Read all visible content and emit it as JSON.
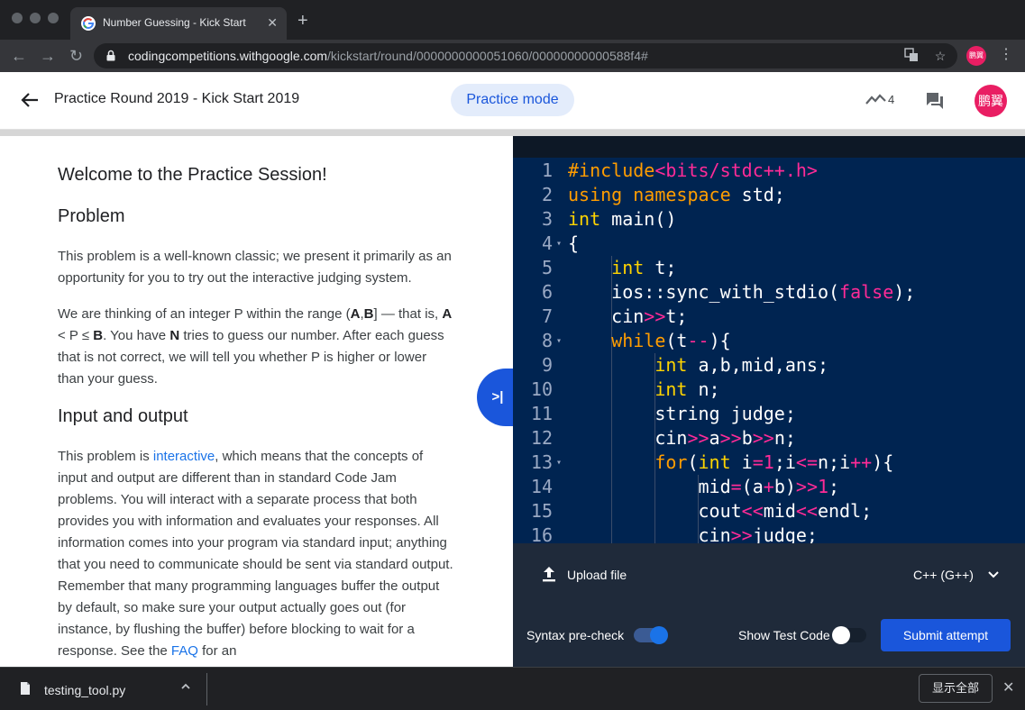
{
  "browser": {
    "tab_title": "Number Guessing - Kick Start",
    "tab_close": "✕",
    "new_tab": "+",
    "url_host": "codingcompetitions.withgoogle.com",
    "url_path": "/kickstart/round/0000000000051060/00000000000588f4#",
    "profile_initials": "鹏翼"
  },
  "header": {
    "title": "Practice Round 2019 - Kick Start 2019",
    "mode_chip": "Practice mode",
    "trend_count": "4",
    "avatar_initials": "鹏翼"
  },
  "problem": {
    "welcome": "Welcome to the Practice Session!",
    "problem_heading": "Problem",
    "intro": "This problem is a well-known classic; we present it primarily as an opportunity for you to try out the interactive judging system.",
    "p2_a": "We are thinking of an integer P within the range (",
    "p2_A": "A",
    "p2_comma": ",",
    "p2_B": "B",
    "p2_b": "] — that is, ",
    "p2_A2": "A",
    "p2_c": " < P ≤ ",
    "p2_B2": "B",
    "p2_d": ". You have ",
    "p2_N": "N",
    "p2_e": " tries to guess our number. After each guess that is not correct, we will tell you whether P is higher or lower than your guess.",
    "io_heading": "Input and output",
    "p3_a": "This problem is ",
    "p3_link": "interactive",
    "p3_b": ", which means that the concepts of input and output are different than in standard Code Jam problems. You will interact with a separate process that both provides you with information and evaluates your responses. All information comes into your program via standard input; anything that you need to communicate should be sent via standard output. Remember that many programming languages buffer the output by default, so make sure your output actually goes out (for instance, by flushing the buffer) before blocking to wait for a response. See the ",
    "p3_faq": "FAQ",
    "p3_c": " for an",
    "collapse_label": ">|"
  },
  "editor": {
    "lines": [
      {
        "n": "1",
        "fold": ""
      },
      {
        "n": "2",
        "fold": ""
      },
      {
        "n": "3",
        "fold": ""
      },
      {
        "n": "4",
        "fold": "▾"
      },
      {
        "n": "5",
        "fold": ""
      },
      {
        "n": "6",
        "fold": ""
      },
      {
        "n": "7",
        "fold": ""
      },
      {
        "n": "8",
        "fold": "▾"
      },
      {
        "n": "9",
        "fold": ""
      },
      {
        "n": "10",
        "fold": ""
      },
      {
        "n": "11",
        "fold": ""
      },
      {
        "n": "12",
        "fold": ""
      },
      {
        "n": "13",
        "fold": "▾"
      },
      {
        "n": "14",
        "fold": ""
      },
      {
        "n": "15",
        "fold": ""
      },
      {
        "n": "16",
        "fold": ""
      }
    ],
    "code": [
      [
        [
          "pp",
          "#include"
        ],
        [
          "inc",
          "<bits/stdc++.h>"
        ]
      ],
      [
        [
          "kw",
          "using"
        ],
        [
          "",
          " "
        ],
        [
          "kw",
          "namespace"
        ],
        [
          "",
          " std;"
        ]
      ],
      [
        [
          "ty",
          "int"
        ],
        [
          "",
          " main()"
        ]
      ],
      [
        [
          "",
          "{"
        ]
      ],
      [
        [
          "",
          "    "
        ],
        [
          "ty",
          "int"
        ],
        [
          "",
          " t;"
        ]
      ],
      [
        [
          "",
          "    ios::sync_with_stdio("
        ],
        [
          "bo",
          "false"
        ],
        [
          "",
          ");"
        ]
      ],
      [
        [
          "",
          "    cin"
        ],
        [
          "op",
          ">>"
        ],
        [
          "",
          "t;"
        ]
      ],
      [
        [
          "",
          "    "
        ],
        [
          "kw",
          "while"
        ],
        [
          "",
          "(t"
        ],
        [
          "op",
          "--"
        ],
        [
          "",
          "){"
        ]
      ],
      [
        [
          "",
          "        "
        ],
        [
          "ty",
          "int"
        ],
        [
          "",
          " a,b,mid,ans;"
        ]
      ],
      [
        [
          "",
          "        "
        ],
        [
          "ty",
          "int"
        ],
        [
          "",
          " n;"
        ]
      ],
      [
        [
          "",
          "        string judge;"
        ]
      ],
      [
        [
          "",
          "        cin"
        ],
        [
          "op",
          ">>"
        ],
        [
          "",
          "a"
        ],
        [
          "op",
          ">>"
        ],
        [
          "",
          "b"
        ],
        [
          "op",
          ">>"
        ],
        [
          "",
          "n;"
        ]
      ],
      [
        [
          "",
          "        "
        ],
        [
          "kw",
          "for"
        ],
        [
          "",
          "("
        ],
        [
          "ty",
          "int"
        ],
        [
          "",
          " i"
        ],
        [
          "op",
          "="
        ],
        [
          "num",
          "1"
        ],
        [
          "",
          ";i"
        ],
        [
          "op",
          "<="
        ],
        [
          "",
          "n;i"
        ],
        [
          "op",
          "++"
        ],
        [
          "",
          "){"
        ]
      ],
      [
        [
          "",
          "            mid"
        ],
        [
          "op",
          "="
        ],
        [
          "",
          "(a"
        ],
        [
          "op",
          "+"
        ],
        [
          "",
          "b)"
        ],
        [
          "op",
          ">>"
        ],
        [
          "num",
          "1"
        ],
        [
          "",
          ";"
        ]
      ],
      [
        [
          "",
          "            cout"
        ],
        [
          "op",
          "<<"
        ],
        [
          "",
          "mid"
        ],
        [
          "op",
          "<<"
        ],
        [
          "",
          "endl;"
        ]
      ],
      [
        [
          "",
          "            cin"
        ],
        [
          "op",
          ">>"
        ],
        [
          "",
          "judge;"
        ]
      ]
    ],
    "upload_label": "Upload file",
    "language": "C++ (G++)",
    "syntax_precheck_label": "Syntax pre-check",
    "syntax_precheck_on": true,
    "show_test_code_label": "Show Test Code",
    "show_test_code_on": false,
    "submit_label": "Submit attempt"
  },
  "downloads": {
    "file_name": "testing_tool.py",
    "show_all": "显示全部"
  },
  "colors": {
    "accent": "#1a56db",
    "editor_bg": "#002451",
    "avatar": "#e91e63"
  }
}
